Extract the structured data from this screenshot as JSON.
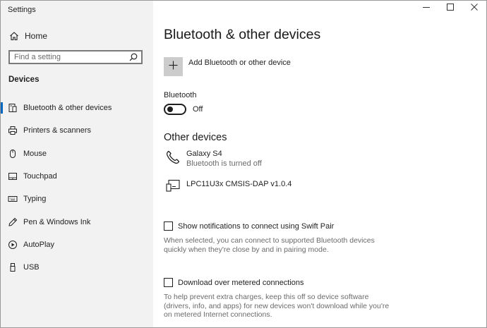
{
  "window": {
    "title": "Settings"
  },
  "sidebar": {
    "home_label": "Home",
    "search_placeholder": "Find a setting",
    "section_label": "Devices",
    "items": [
      {
        "label": "Bluetooth & other devices",
        "icon": "bluetooth-devices-icon",
        "active": true
      },
      {
        "label": "Printers & scanners",
        "icon": "printer-icon",
        "active": false
      },
      {
        "label": "Mouse",
        "icon": "mouse-icon",
        "active": false
      },
      {
        "label": "Touchpad",
        "icon": "touchpad-icon",
        "active": false
      },
      {
        "label": "Typing",
        "icon": "keyboard-icon",
        "active": false
      },
      {
        "label": "Pen & Windows Ink",
        "icon": "pen-icon",
        "active": false
      },
      {
        "label": "AutoPlay",
        "icon": "autoplay-icon",
        "active": false
      },
      {
        "label": "USB",
        "icon": "usb-icon",
        "active": false
      }
    ]
  },
  "main": {
    "title": "Bluetooth & other devices",
    "add_device_label": "Add Bluetooth or other device",
    "bluetooth_label": "Bluetooth",
    "bluetooth_state": "Off",
    "other_devices_title": "Other devices",
    "devices": [
      {
        "name": "Galaxy S4",
        "status": "Bluetooth is turned off",
        "icon": "phone-icon"
      },
      {
        "name": "LPC11U3x CMSIS-DAP v1.0.4",
        "status": "",
        "icon": "device-icon"
      }
    ],
    "swift_pair": {
      "label": "Show notifications to connect using Swift Pair",
      "description": "When selected, you can connect to supported Bluetooth devices quickly when they're close by and in pairing mode."
    },
    "metered": {
      "label": "Download over metered connections",
      "description": "To help prevent extra charges, keep this off so device software (drivers, info, and apps) for new devices won't download while you're on metered Internet connections."
    }
  },
  "colors": {
    "accent": "#0067c0",
    "sidebar_bg": "#f2f2f2",
    "add_tile": "#cccccc"
  }
}
